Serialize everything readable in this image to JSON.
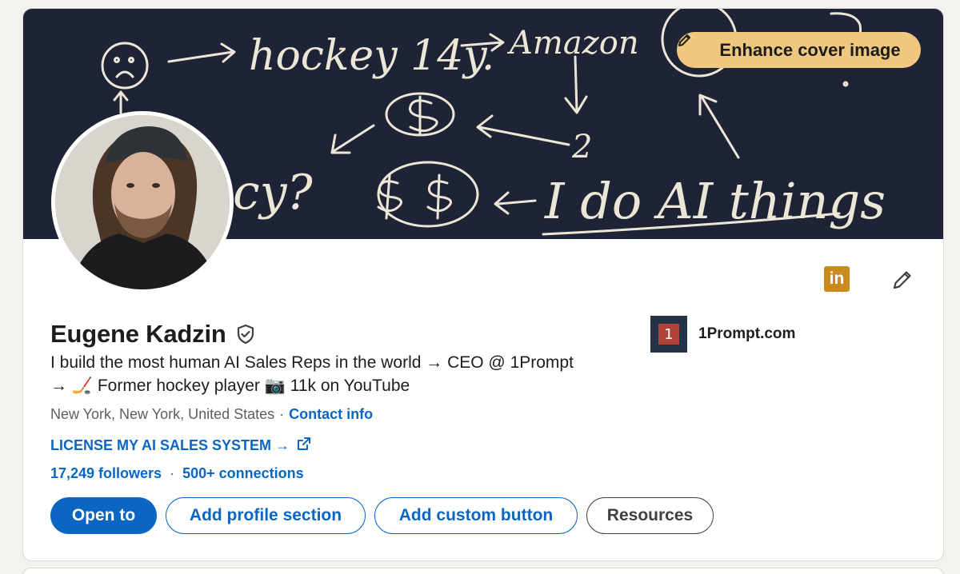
{
  "cover": {
    "enhance_label": "Enhance cover image",
    "board_text": [
      "hockey 14y.",
      "Amazon",
      "2",
      "I do AI things",
      "cy?"
    ]
  },
  "profile": {
    "name": "Eugene Kadzin",
    "headline_line1": "I build the most human AI Sales Reps in the world → CEO @ 1Prompt",
    "headline_line2": "→ 🏒 Former hockey player 📷 11k on YouTube",
    "location": "New York, New York, United States",
    "location_separator": "·",
    "contact_label": "Contact info",
    "license_label": "LICENSE MY AI SALES SYSTEM →",
    "followers": "17,249 followers",
    "stats_separator": "·",
    "connections": "500+ connections"
  },
  "company": {
    "logo_glyph": "1",
    "name": "1Prompt.com"
  },
  "actions": {
    "open_to": "Open to",
    "add_section": "Add profile section",
    "add_custom": "Add custom button",
    "resources": "Resources"
  },
  "icons": {
    "linkedin_glyph": "in"
  },
  "colors": {
    "accent": "#0a66c2",
    "cover_bg": "#1e2436",
    "enhance_bg": "#f0c77e",
    "linkedin_badge": "#c98a1e"
  }
}
